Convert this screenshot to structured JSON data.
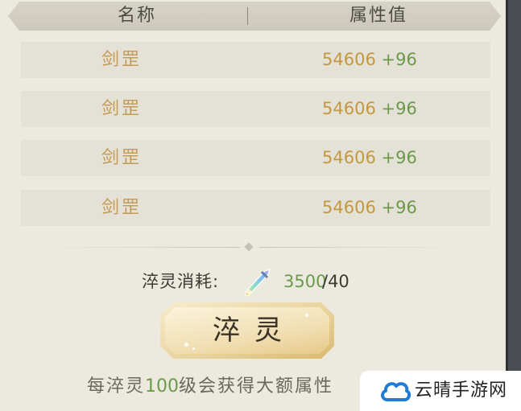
{
  "table": {
    "headers": {
      "name": "名称",
      "value": "属性值"
    },
    "rows": [
      {
        "name": "剑罡",
        "base": "54606",
        "bonus": "+96"
      },
      {
        "name": "剑罡",
        "base": "54606",
        "bonus": "+96"
      },
      {
        "name": "剑罡",
        "base": "54606",
        "bonus": "+96"
      },
      {
        "name": "剑罡",
        "base": "54606",
        "bonus": "+96"
      }
    ]
  },
  "cost": {
    "label": "淬灵消耗:",
    "item_icon": "sword-crystal-icon",
    "have": "3500",
    "need": "/40"
  },
  "button": {
    "label": "淬灵"
  },
  "hint": {
    "prefix": "每淬灵",
    "level": "100",
    "suffix": "级会获得大额属性"
  },
  "watermark": {
    "text": "云晴手游网",
    "logo_icon": "cloud-logo-icon"
  },
  "colors": {
    "attribute_value": "#c4983f",
    "bonus_green": "#6b9a4a",
    "name_gold": "#c49b56",
    "background": "#eceadf"
  }
}
